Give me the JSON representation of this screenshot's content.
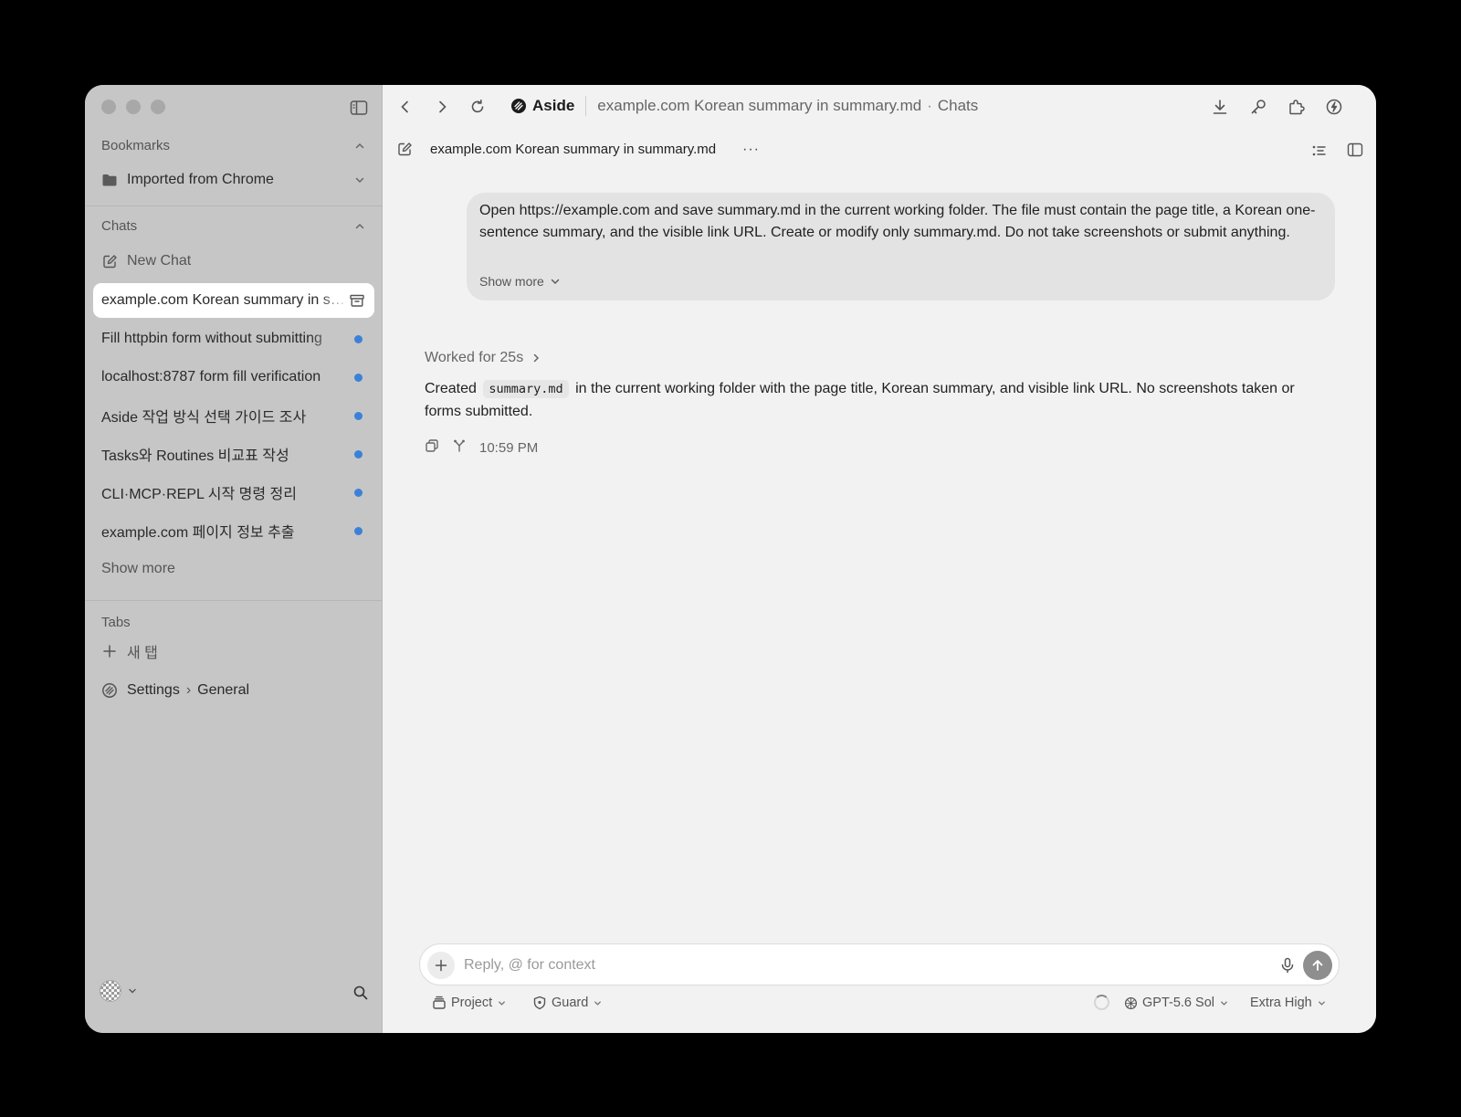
{
  "browser": {
    "brand": "Aside",
    "page_title": "example.com Korean summary in summary.md",
    "section": "Chats",
    "separator": "·"
  },
  "sidebar": {
    "bookmarks": {
      "header": "Bookmarks",
      "items": [
        {
          "label": "Imported from Chrome"
        }
      ]
    },
    "chats": {
      "header": "Chats",
      "new_chat": "New Chat",
      "active": "example.com Korean summary in summary.md",
      "items": [
        {
          "label": "Fill httpbin form without submitting",
          "unread": true
        },
        {
          "label": "localhost:8787 form fill verification",
          "unread": true
        },
        {
          "label": "Aside 작업 방식 선택 가이드 조사",
          "unread": true
        },
        {
          "label": "Tasks와 Routines 비교표 작성",
          "unread": true
        },
        {
          "label": "CLI·MCP·REPL 시작 명령 정리",
          "unread": true
        },
        {
          "label": "example.com 페이지 정보 추출",
          "unread": true
        }
      ],
      "show_more": "Show more"
    },
    "tabs": {
      "header": "Tabs",
      "new_tab": "새 탭",
      "items": [
        {
          "label": "Settings",
          "chevron": "›",
          "sub": "General"
        }
      ]
    }
  },
  "conversation": {
    "title": "example.com Korean summary in summary.md",
    "more": "···",
    "user_message": "Open https://example.com and save summary.md in the current working folder. The file must contain the page title, a Korean one-sentence summary, and the visible link URL. Create or modify only summary.md. Do not take screenshots or submit anything.",
    "show_more": "Show more",
    "worked_for": "Worked for 25s",
    "reply": {
      "before": "Created",
      "code": "summary.md",
      "after": "in the current working folder with the page title, Korean summary, and visible link URL. No screenshots taken or forms submitted."
    },
    "time": "10:59 PM"
  },
  "composer": {
    "placeholder": "Reply, @ for context",
    "project": "Project",
    "guard": "Guard",
    "model": "GPT-5.6 Sol",
    "effort": "Extra High"
  },
  "colors": {
    "unread_dot": "#3a82d8",
    "sidebar_bg": "#c6c6c6",
    "main_bg": "#f2f2f2",
    "send_button": "#8e8e8e"
  }
}
